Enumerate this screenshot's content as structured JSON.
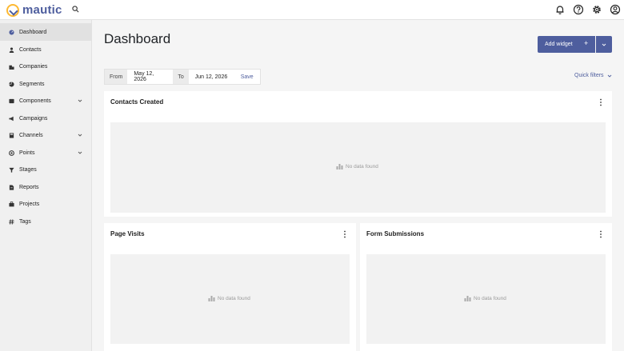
{
  "app": {
    "name": "mautic"
  },
  "header": {
    "icons": [
      "search-icon",
      "bell-icon",
      "help-icon",
      "gear-icon",
      "user-icon"
    ]
  },
  "sidebar": {
    "items": [
      {
        "label": "Dashboard",
        "icon": "dashboard-icon",
        "active": true,
        "has_submenu": false
      },
      {
        "label": "Contacts",
        "icon": "contacts-icon",
        "has_submenu": false
      },
      {
        "label": "Companies",
        "icon": "companies-icon",
        "has_submenu": false
      },
      {
        "label": "Segments",
        "icon": "segments-icon",
        "has_submenu": false
      },
      {
        "label": "Components",
        "icon": "components-icon",
        "has_submenu": true
      },
      {
        "label": "Campaigns",
        "icon": "campaigns-icon",
        "has_submenu": false
      },
      {
        "label": "Channels",
        "icon": "channels-icon",
        "has_submenu": true
      },
      {
        "label": "Points",
        "icon": "points-icon",
        "has_submenu": true
      },
      {
        "label": "Stages",
        "icon": "stages-icon",
        "has_submenu": false
      },
      {
        "label": "Reports",
        "icon": "reports-icon",
        "has_submenu": false
      },
      {
        "label": "Projects",
        "icon": "projects-icon",
        "has_submenu": false
      },
      {
        "label": "Tags",
        "icon": "tags-icon",
        "has_submenu": false
      }
    ]
  },
  "main": {
    "title": "Dashboard",
    "add_widget_label": "Add widget",
    "add_widget_plus": "+",
    "filter": {
      "from_label": "From",
      "from_value": "May 12, 2026",
      "to_label": "To",
      "to_value": "Jun 12, 2026",
      "save_label": "Save"
    },
    "quick_filters_label": "Quick filters",
    "widgets": [
      {
        "title": "Contacts Created",
        "empty_text": "No data found"
      },
      {
        "title": "Page Visits",
        "empty_text": "No data found"
      },
      {
        "title": "Form Submissions",
        "empty_text": "No data found"
      }
    ]
  },
  "colors": {
    "brand": "#4e5e9e",
    "logo_accent": "#fdb933",
    "sidebar_bg": "#f0f0f0",
    "active_item_bg": "#e1e1e1",
    "page_bg": "#f5f5f5",
    "chart_placeholder_bg": "#f2f2f2"
  }
}
